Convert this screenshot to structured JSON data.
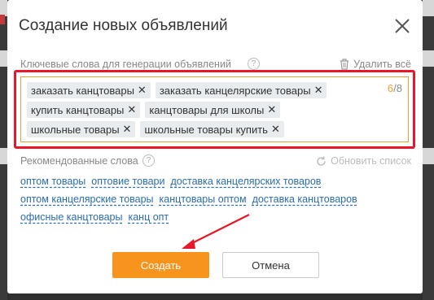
{
  "dialog": {
    "title": "Создание новых объявлений"
  },
  "keywords": {
    "label": "Ключевые слова для генерации объявлений",
    "help": "?",
    "delete_all": "Удалить всё",
    "count_current": "6",
    "count_sep": "/",
    "count_max": "8",
    "tags": [
      [
        "заказать канцтовары",
        "заказать канцелярские товары"
      ],
      [
        "купить канцтовары",
        "канцтовары для школы"
      ],
      [
        "школьные товары",
        "школьные товары купить"
      ]
    ]
  },
  "recommended": {
    "label": "Рекомендованные слова",
    "help": "?",
    "refresh": "Обновить список",
    "lines": [
      [
        "оптом товары",
        "оптовие товари",
        "доставка канцелярских товаров"
      ],
      [
        "оптом канцелярские товары",
        "канцтовары оптом",
        "доставка канцтоваров"
      ],
      [
        "офисные канцтовары",
        "канц опт"
      ]
    ]
  },
  "buttons": {
    "create": "Создать",
    "cancel": "Отмена"
  },
  "colors": {
    "accent": "#f7941d",
    "highlight_border": "#e8182a",
    "link": "#2a6db0"
  }
}
